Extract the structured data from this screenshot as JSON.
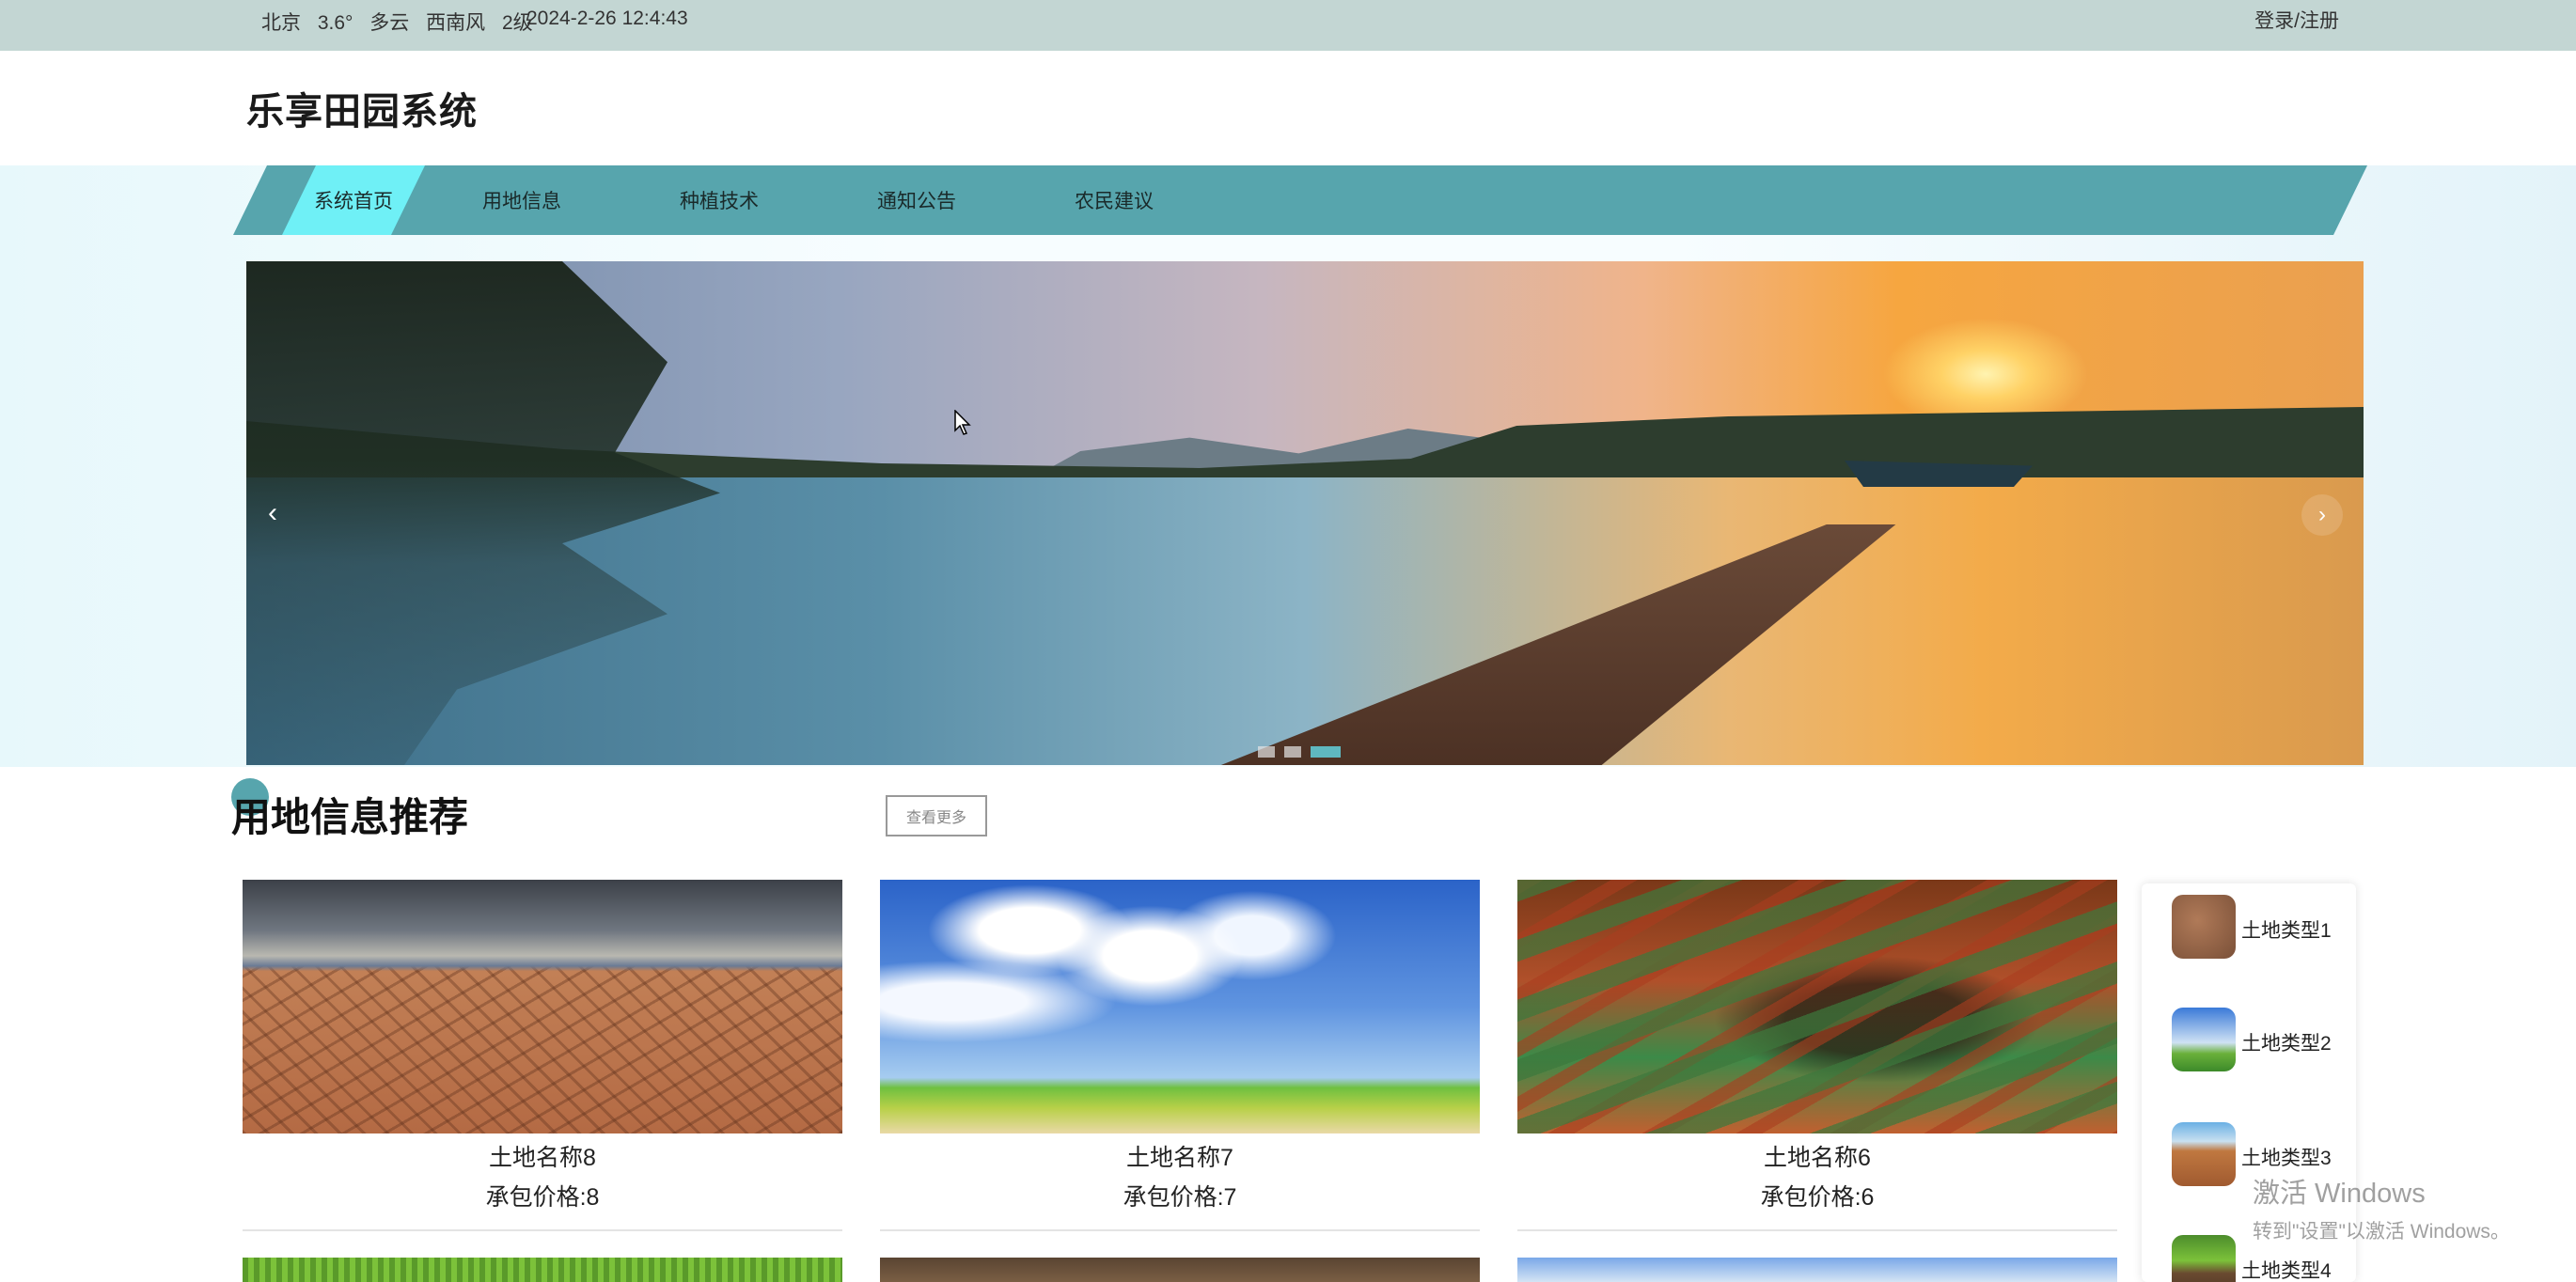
{
  "topbar": {
    "city": "北京",
    "temperature": "3.6°",
    "condition": "多云",
    "wind": "西南风",
    "wind_level": "2级",
    "datetime": "2024-2-26 12:4:43",
    "login_label": "登录/注册"
  },
  "header": {
    "site_title": "乐享田园系统"
  },
  "nav": {
    "items": [
      {
        "label": "系统首页",
        "active": true
      },
      {
        "label": "用地信息"
      },
      {
        "label": "种植技术"
      },
      {
        "label": "通知公告"
      },
      {
        "label": "农民建议"
      }
    ],
    "active_color": "#6ff0f6",
    "bar_color": "#57a5ad"
  },
  "banner": {
    "prev_icon": "‹",
    "next_icon": "›",
    "slide_count": 3,
    "active_slide": 3
  },
  "section": {
    "title": "用地信息推荐",
    "more_label": "查看更多"
  },
  "land_cards": [
    {
      "name": "土地名称8",
      "price": "承包价格:8"
    },
    {
      "name": "土地名称7",
      "price": "承包价格:7"
    },
    {
      "name": "土地名称6",
      "price": "承包价格:6"
    }
  ],
  "land_types": [
    {
      "label": "土地类型1"
    },
    {
      "label": "土地类型2"
    },
    {
      "label": "土地类型3"
    },
    {
      "label": "土地类型4"
    }
  ],
  "watermark": {
    "line1": "激活 Windows",
    "line2": "转到\"设置\"以激活 Windows。"
  }
}
